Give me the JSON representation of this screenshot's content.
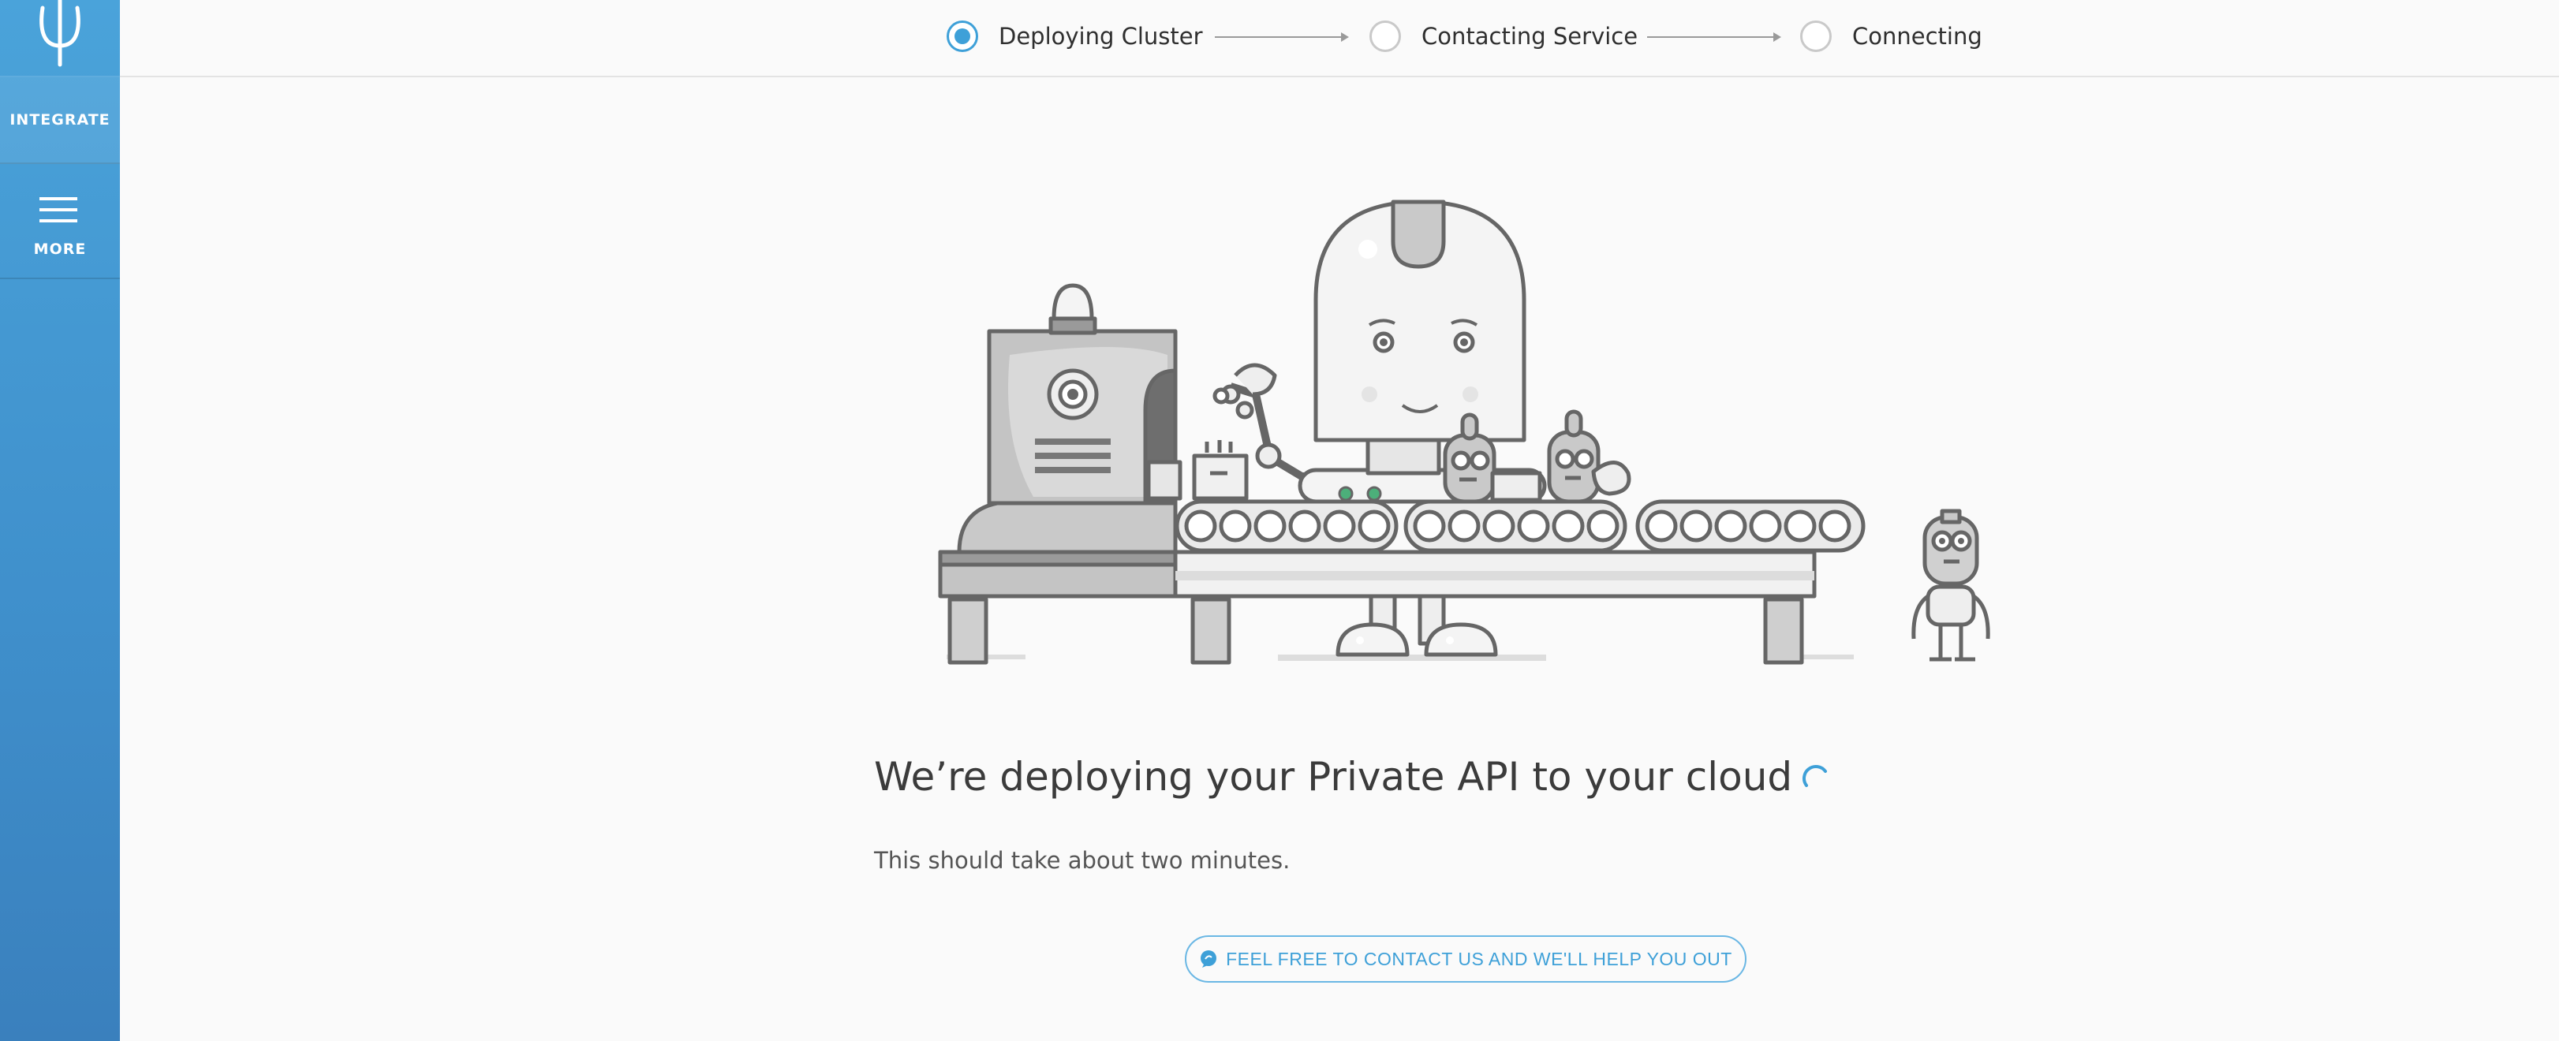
{
  "sidebar": {
    "logo_icon": "phi-logo-icon",
    "integrate_label": "INTEGRATE",
    "more_label": "MORE",
    "more_icon": "hamburger-menu-icon"
  },
  "stepper": {
    "steps": [
      {
        "label": "Deploying Cluster",
        "state": "active"
      },
      {
        "label": "Contacting Service",
        "state": "pending"
      },
      {
        "label": "Connecting",
        "state": "pending"
      }
    ]
  },
  "main": {
    "headline": "We’re deploying your Private API to your cloud",
    "subtext": "This should take about two minutes.",
    "contact_button_label": "FEEL FREE TO CONTACT US AND WE'LL HELP YOU OUT",
    "contact_icon": "chat-bubble-icon",
    "illustration": "robot-factory-conveyor-illustration"
  },
  "colors": {
    "accent": "#3ea0d8",
    "sidebar": "#4196d0"
  }
}
